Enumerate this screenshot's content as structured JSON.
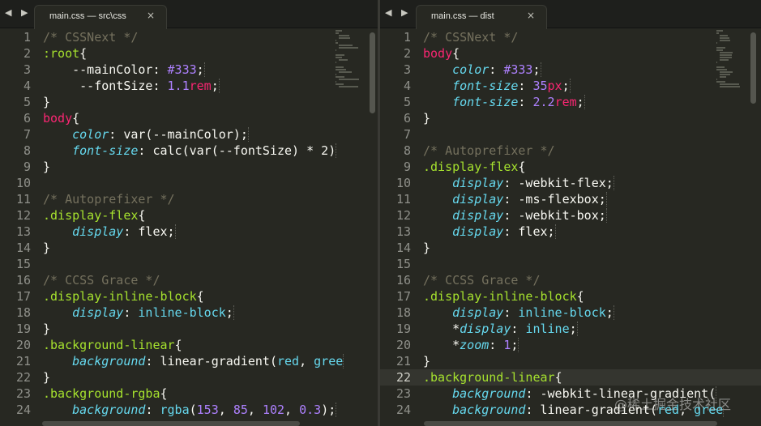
{
  "left": {
    "nav": "◀ ▶",
    "tab": {
      "title": "main.css — src\\css",
      "close": "×"
    },
    "lines": [
      {
        "n": "1",
        "t": [
          [
            "c",
            "/* CSSNext */"
          ]
        ]
      },
      {
        "n": "2",
        "t": [
          [
            "sel",
            ":root"
          ],
          [
            "p",
            "{"
          ]
        ]
      },
      {
        "n": "3",
        "t": [
          [
            "p",
            "    --mainColor: "
          ],
          [
            "num",
            "#333"
          ],
          [
            "p",
            ";"
          ]
        ]
      },
      {
        "n": "4",
        "t": [
          [
            "p",
            "     --fontSize: "
          ],
          [
            "num",
            "1.1"
          ],
          [
            "unit",
            "rem"
          ],
          [
            "p",
            ";"
          ]
        ]
      },
      {
        "n": "5",
        "t": [
          [
            "p",
            "}"
          ]
        ]
      },
      {
        "n": "6",
        "t": [
          [
            "tag",
            "body"
          ],
          [
            "p",
            "{"
          ]
        ]
      },
      {
        "n": "7",
        "t": [
          [
            "p",
            "    "
          ],
          [
            "prop",
            "color"
          ],
          [
            "p",
            ": var(--mainColor);"
          ]
        ]
      },
      {
        "n": "8",
        "t": [
          [
            "p",
            "    "
          ],
          [
            "prop",
            "font-size"
          ],
          [
            "p",
            ": calc(var(--fontSize) * 2)"
          ]
        ]
      },
      {
        "n": "9",
        "t": [
          [
            "p",
            "}"
          ]
        ]
      },
      {
        "n": "10",
        "t": []
      },
      {
        "n": "11",
        "t": [
          [
            "c",
            "/* Autoprefixer */"
          ]
        ]
      },
      {
        "n": "12",
        "t": [
          [
            "sel",
            ".display-flex"
          ],
          [
            "p",
            "{"
          ]
        ]
      },
      {
        "n": "13",
        "t": [
          [
            "p",
            "    "
          ],
          [
            "prop",
            "display"
          ],
          [
            "p",
            ": flex;"
          ]
        ]
      },
      {
        "n": "14",
        "t": [
          [
            "p",
            "}"
          ]
        ]
      },
      {
        "n": "15",
        "t": []
      },
      {
        "n": "16",
        "t": [
          [
            "c",
            "/* CCSS Grace */"
          ]
        ]
      },
      {
        "n": "17",
        "t": [
          [
            "sel",
            ".display-inline-block"
          ],
          [
            "p",
            "{"
          ]
        ]
      },
      {
        "n": "18",
        "t": [
          [
            "p",
            "    "
          ],
          [
            "prop",
            "display"
          ],
          [
            "p",
            ": "
          ],
          [
            "kw",
            "inline-block"
          ],
          [
            "p",
            ";"
          ]
        ]
      },
      {
        "n": "19",
        "t": [
          [
            "p",
            "}"
          ]
        ]
      },
      {
        "n": "20",
        "t": [
          [
            "sel",
            ".background-linear"
          ],
          [
            "p",
            "{"
          ]
        ]
      },
      {
        "n": "21",
        "t": [
          [
            "p",
            "    "
          ],
          [
            "prop",
            "background"
          ],
          [
            "p",
            ": linear-gradient("
          ],
          [
            "kw",
            "red"
          ],
          [
            "p",
            ", "
          ],
          [
            "kw",
            "gree"
          ]
        ]
      },
      {
        "n": "22",
        "t": [
          [
            "p",
            "}"
          ]
        ]
      },
      {
        "n": "23",
        "t": [
          [
            "sel",
            ".background-rgba"
          ],
          [
            "p",
            "{"
          ]
        ]
      },
      {
        "n": "24",
        "t": [
          [
            "p",
            "    "
          ],
          [
            "prop",
            "background"
          ],
          [
            "p",
            ": "
          ],
          [
            "fn",
            "rgba"
          ],
          [
            "p",
            "("
          ],
          [
            "num",
            "153"
          ],
          [
            "p",
            ", "
          ],
          [
            "num",
            "85"
          ],
          [
            "p",
            ", "
          ],
          [
            "num",
            "102"
          ],
          [
            "p",
            ", "
          ],
          [
            "num",
            "0.3"
          ],
          [
            "p",
            ");"
          ]
        ]
      }
    ]
  },
  "right": {
    "nav": "◀ ▶",
    "tab": {
      "title": "main.css — dist",
      "close": "×"
    },
    "active_line": "22",
    "lines": [
      {
        "n": "1",
        "t": [
          [
            "c",
            "/* CSSNext */"
          ]
        ]
      },
      {
        "n": "2",
        "t": [
          [
            "tag",
            "body"
          ],
          [
            "p",
            "{"
          ]
        ]
      },
      {
        "n": "3",
        "t": [
          [
            "p",
            "    "
          ],
          [
            "prop",
            "color"
          ],
          [
            "p",
            ": "
          ],
          [
            "num",
            "#333"
          ],
          [
            "p",
            ";"
          ]
        ]
      },
      {
        "n": "4",
        "t": [
          [
            "p",
            "    "
          ],
          [
            "prop",
            "font-size"
          ],
          [
            "p",
            ": "
          ],
          [
            "num",
            "35"
          ],
          [
            "unit",
            "px"
          ],
          [
            "p",
            ";"
          ]
        ]
      },
      {
        "n": "5",
        "t": [
          [
            "p",
            "    "
          ],
          [
            "prop",
            "font-size"
          ],
          [
            "p",
            ": "
          ],
          [
            "num",
            "2.2"
          ],
          [
            "unit",
            "rem"
          ],
          [
            "p",
            ";"
          ]
        ]
      },
      {
        "n": "6",
        "t": [
          [
            "p",
            "}"
          ]
        ]
      },
      {
        "n": "7",
        "t": []
      },
      {
        "n": "8",
        "t": [
          [
            "c",
            "/* Autoprefixer */"
          ]
        ]
      },
      {
        "n": "9",
        "t": [
          [
            "sel",
            ".display-flex"
          ],
          [
            "p",
            "{"
          ]
        ]
      },
      {
        "n": "10",
        "t": [
          [
            "p",
            "    "
          ],
          [
            "prop",
            "display"
          ],
          [
            "p",
            ": -webkit-flex;"
          ]
        ]
      },
      {
        "n": "11",
        "t": [
          [
            "p",
            "    "
          ],
          [
            "prop",
            "display"
          ],
          [
            "p",
            ": -ms-flexbox;"
          ]
        ]
      },
      {
        "n": "12",
        "t": [
          [
            "p",
            "    "
          ],
          [
            "prop",
            "display"
          ],
          [
            "p",
            ": -webkit-box;"
          ]
        ]
      },
      {
        "n": "13",
        "t": [
          [
            "p",
            "    "
          ],
          [
            "prop",
            "display"
          ],
          [
            "p",
            ": flex;"
          ]
        ]
      },
      {
        "n": "14",
        "t": [
          [
            "p",
            "}"
          ]
        ]
      },
      {
        "n": "15",
        "t": []
      },
      {
        "n": "16",
        "t": [
          [
            "c",
            "/* CCSS Grace */"
          ]
        ]
      },
      {
        "n": "17",
        "t": [
          [
            "sel",
            ".display-inline-block"
          ],
          [
            "p",
            "{"
          ]
        ]
      },
      {
        "n": "18",
        "t": [
          [
            "p",
            "    "
          ],
          [
            "prop",
            "display"
          ],
          [
            "p",
            ": "
          ],
          [
            "kw",
            "inline-block"
          ],
          [
            "p",
            ";"
          ]
        ]
      },
      {
        "n": "19",
        "t": [
          [
            "p",
            "    *"
          ],
          [
            "prop",
            "display"
          ],
          [
            "p",
            ": "
          ],
          [
            "kw",
            "inline"
          ],
          [
            "p",
            ";"
          ]
        ]
      },
      {
        "n": "20",
        "t": [
          [
            "p",
            "    *"
          ],
          [
            "prop",
            "zoom"
          ],
          [
            "p",
            ": "
          ],
          [
            "num",
            "1"
          ],
          [
            "p",
            ";"
          ]
        ]
      },
      {
        "n": "21",
        "t": [
          [
            "p",
            "}"
          ]
        ]
      },
      {
        "n": "22",
        "t": [
          [
            "sel",
            ".background-linear"
          ],
          [
            "p",
            "{"
          ]
        ]
      },
      {
        "n": "23",
        "t": [
          [
            "p",
            "    "
          ],
          [
            "prop",
            "background"
          ],
          [
            "p",
            ": -webkit-linear-gradient("
          ]
        ]
      },
      {
        "n": "24",
        "t": [
          [
            "p",
            "    "
          ],
          [
            "prop",
            "background"
          ],
          [
            "p",
            ": linear-gradient("
          ],
          [
            "kw",
            "red"
          ],
          [
            "p",
            ", "
          ],
          [
            "kw",
            "gree"
          ]
        ]
      }
    ]
  },
  "watermark": "@稀土掘金技术社区"
}
